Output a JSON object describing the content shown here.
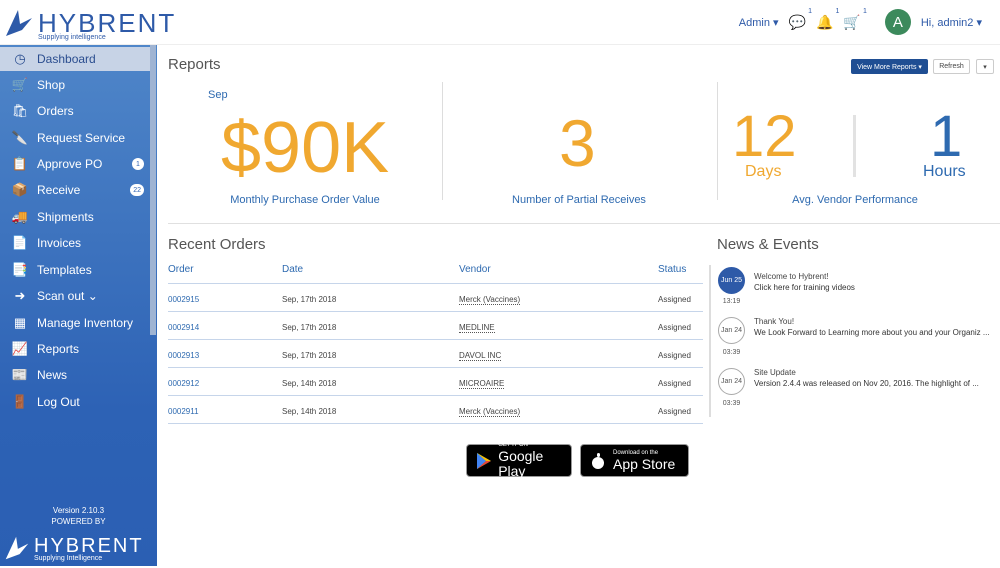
{
  "header": {
    "brand": "HYBRENT",
    "tagline": "Supplying intelligence",
    "admin_menu": "Admin ▾",
    "chat_count": "1",
    "bell_count": "1",
    "cart_count": "1",
    "avatar_letter": "A",
    "greeting": "Hi, admin2 ▾"
  },
  "sidebar": {
    "items": [
      {
        "label": "Dashboard",
        "icon": "dashboard-icon"
      },
      {
        "label": "Shop",
        "icon": "cart-icon"
      },
      {
        "label": "Orders",
        "icon": "orders-icon"
      },
      {
        "label": "Request Service",
        "icon": "service-icon"
      },
      {
        "label": "Approve PO",
        "icon": "approve-icon",
        "badge": "1"
      },
      {
        "label": "Receive",
        "icon": "receive-icon",
        "badge": "22"
      },
      {
        "label": "Shipments",
        "icon": "truck-icon"
      },
      {
        "label": "Invoices",
        "icon": "invoice-icon"
      },
      {
        "label": "Templates",
        "icon": "template-icon"
      },
      {
        "label": "Scan out ⌄",
        "icon": "scan-icon"
      },
      {
        "label": "Manage Inventory",
        "icon": "inventory-icon"
      },
      {
        "label": "Reports",
        "icon": "chart-icon"
      },
      {
        "label": "News",
        "icon": "news-icon"
      },
      {
        "label": "Log Out",
        "icon": "logout-icon"
      }
    ],
    "version": "Version 2.10.3",
    "powered_by": "POWERED BY",
    "footer_brand": "HYBRENT",
    "footer_tagline": "Supplying Intelligence"
  },
  "reports": {
    "title": "Reports",
    "view_more": "View More Reports ▾",
    "refresh": "Refresh",
    "dropdown": "▾",
    "month": "Sep",
    "po_value": "$90K",
    "po_label": "Monthly Purchase Order Value",
    "partial_value": "3",
    "partial_label": "Number of Partial Receives",
    "days_value": "12",
    "days_unit": "Days",
    "hours_value": "1",
    "hours_unit": "Hours",
    "vendor_label": "Avg. Vendor Performance"
  },
  "orders": {
    "title": "Recent Orders",
    "columns": [
      "Order",
      "Date",
      "Vendor",
      "Status"
    ],
    "rows": [
      {
        "order": "0002915",
        "date": "Sep, 17th 2018",
        "vendor": "Merck (Vaccines)",
        "status": "Assigned"
      },
      {
        "order": "0002914",
        "date": "Sep, 17th 2018",
        "vendor": "MEDLINE",
        "status": "Assigned"
      },
      {
        "order": "0002913",
        "date": "Sep, 17th 2018",
        "vendor": "DAVOL INC",
        "status": "Assigned"
      },
      {
        "order": "0002912",
        "date": "Sep, 14th 2018",
        "vendor": "MICROAIRE",
        "status": "Assigned"
      },
      {
        "order": "0002911",
        "date": "Sep, 14th 2018",
        "vendor": "Merck (Vaccines)",
        "status": "Assigned"
      }
    ]
  },
  "news": {
    "title": "News & Events",
    "items": [
      {
        "date": "Jun 25",
        "time": "13:19",
        "title": "Welcome to Hybrent!",
        "body": "Click here for training videos"
      },
      {
        "date": "Jan 24",
        "time": "03:39",
        "title": "Thank You!",
        "body": "We Look Forward to Learning more about you and your Organiz ..."
      },
      {
        "date": "Jan 24",
        "time": "03:39",
        "title": "Site Update",
        "body": "Version 2.4.4 was released on Nov 20, 2016.  The highlight of ..."
      }
    ]
  },
  "apps": {
    "google_small": "GET IT ON",
    "google_big": "Google Play",
    "apple_small": "Download on the",
    "apple_big": "App Store"
  },
  "colors": {
    "accent": "#2e5aa8",
    "kpi": "#f0a830",
    "sidebar": "#2d62b5"
  }
}
